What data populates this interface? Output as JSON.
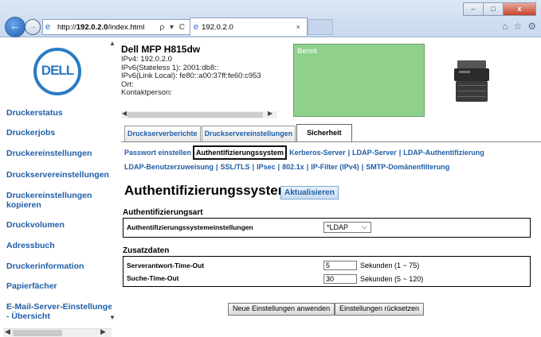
{
  "browser": {
    "url_prefix": "http://",
    "url_host": "192.0.2.0",
    "url_path": "/index.html",
    "tab_title": "192.0.2.0",
    "address_controls": "ρ ▾ C",
    "tab_close": "×",
    "back_glyph": "←",
    "forward_glyph": "→",
    "home_icon": "home-icon",
    "favorites_icon": "star-icon",
    "settings_icon": "gear-icon"
  },
  "window_controls": {
    "minimize": "–",
    "maximize": "□",
    "close": "x"
  },
  "sidebar": {
    "logo_text": "DELL",
    "items": [
      {
        "label": "Druckerstatus"
      },
      {
        "label": "Druckerjobs"
      },
      {
        "label": "Druckereinstellungen"
      },
      {
        "label": "Druckservereinstellungen"
      },
      {
        "label": "Druckereinstellungen kopieren"
      },
      {
        "label": "Druckvolumen"
      },
      {
        "label": "Adressbuch"
      },
      {
        "label": "Druckerinformation"
      },
      {
        "label": "Papierfächer"
      },
      {
        "label": "E-Mail-Server-Einstellungen - Übersicht"
      }
    ]
  },
  "header": {
    "printer_name": "Dell MFP H815dw",
    "info_lines": [
      "IPv4: 192.0.2.0",
      "IPv6(Stateless 1): 2001:db8::",
      "IPv6(Link Local): fe80::a00:37ff:fe60:c953",
      "Ort:",
      "Kontaktperson:"
    ],
    "status": "Bereit"
  },
  "tabs": [
    {
      "label": "Druckserverberichte"
    },
    {
      "label": "Druckservereinstellungen"
    },
    {
      "label": "Sicherheit"
    }
  ],
  "sublinks_row1": [
    {
      "label": "Passwort einstellen"
    },
    {
      "label": "Authentifizierungssystem"
    },
    {
      "label": "Kerberos-Server"
    },
    {
      "label": "LDAP-Server"
    },
    {
      "label": "LDAP-Authentifizierung"
    }
  ],
  "sublinks_row2": [
    {
      "label": "LDAP-Benutzerzuweisung"
    },
    {
      "label": "SSL/TLS"
    },
    {
      "label": "IPsec"
    },
    {
      "label": "802.1x"
    },
    {
      "label": "IP-Filter (IPv4)"
    },
    {
      "label": "SMTP-Domänenfilterung"
    }
  ],
  "separator": "|",
  "main": {
    "title": "Authentifizierungssystem -",
    "refresh_label": "Aktualisieren",
    "section1": {
      "heading": "Authentifizierungsart",
      "row_label": "Authentifizierungssystemeinstellungen",
      "select_value": "*LDAP"
    },
    "section2": {
      "heading": "Zusatzdaten",
      "rows": [
        {
          "label": "Serverantwort-Time-Out",
          "value": "5",
          "range": "Sekunden (1 ~ 75)"
        },
        {
          "label": "Suche-Time-Out",
          "value": "30",
          "range": "Sekunden (5 ~ 120)"
        }
      ]
    },
    "apply_label": "Neue Einstellungen anwenden",
    "reset_label": "Einstellungen rücksetzen"
  }
}
